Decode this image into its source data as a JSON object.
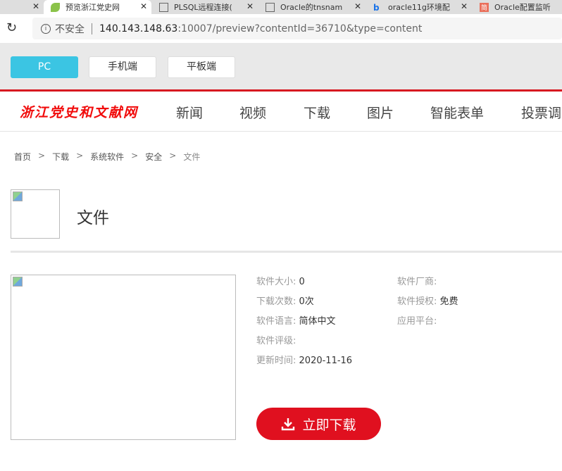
{
  "browser": {
    "tabs": [
      {
        "title": "预览浙江党史网",
        "active": true
      },
      {
        "title": "PLSQL远程连接("
      },
      {
        "title": "Oracle的tnsnam"
      },
      {
        "title": "oracle11g环境配"
      },
      {
        "title": "Oracle配置监听"
      }
    ],
    "security": "不安全",
    "url_host": "140.143.148.63",
    "url_rest": ":10007/preview?contentId=36710&type=content"
  },
  "devices": [
    "PC",
    "手机端",
    "平板端"
  ],
  "site": {
    "logo": "浙江党史和文献网",
    "nav": [
      "新闻",
      "视频",
      "下载",
      "图片",
      "智能表单",
      "投票调"
    ]
  },
  "breadcrumb": [
    "首页",
    "下载",
    "系统软件",
    "安全",
    "文件"
  ],
  "breadcrumb_sep": ">",
  "page_title": "文件",
  "details": {
    "size_label": "软件大小:",
    "size": "0",
    "vendor_label": "软件厂商:",
    "vendor": "",
    "downloads_label": "下载次数:",
    "downloads": "0次",
    "license_label": "软件授权:",
    "license": "免费",
    "language_label": "软件语言:",
    "language": "简体中文",
    "platform_label": "应用平台:",
    "platform": "",
    "rating_label": "软件评级:",
    "rating": "",
    "updated_label": "更新时间:",
    "updated": "2020-11-16"
  },
  "download_button": "立即下载",
  "colors": {
    "accent": "#e0101f",
    "pc": "#3bc5e3"
  }
}
